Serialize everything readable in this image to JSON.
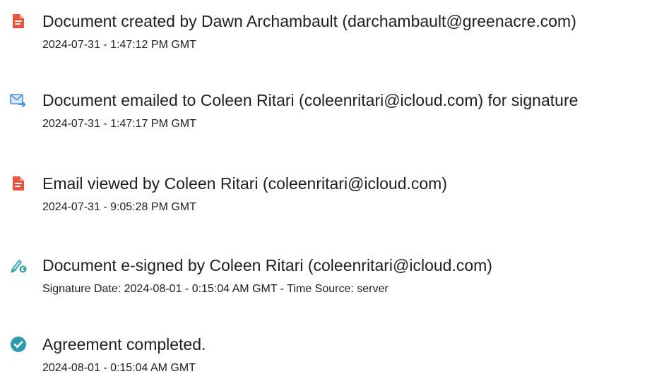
{
  "events": [
    {
      "icon": "document-icon",
      "title": "Document created by Dawn Archambault (darchambault@greenacre.com)",
      "meta": "2024-07-31 - 1:47:12 PM GMT"
    },
    {
      "icon": "email-sent-icon",
      "title": "Document emailed to Coleen Ritari (coleenritari@icloud.com) for signature",
      "meta": "2024-07-31 - 1:47:17 PM GMT"
    },
    {
      "icon": "document-icon",
      "title": "Email viewed by Coleen Ritari (coleenritari@icloud.com)",
      "meta": "2024-07-31 - 9:05:28 PM GMT"
    },
    {
      "icon": "e-sign-pen-icon",
      "title": "Document e-signed by Coleen Ritari (coleenritari@icloud.com)",
      "meta": "Signature Date: 2024-08-01 - 0:15:04 AM GMT - Time Source: server"
    },
    {
      "icon": "check-circle-icon",
      "title": "Agreement completed.",
      "meta": "2024-08-01 - 0:15:04 AM GMT"
    }
  ],
  "colors": {
    "document_icon": "#e8553f",
    "email_icon": "#4a90d9",
    "sign_icon": "#2e9fa6",
    "check_icon": "#2c9bb0",
    "text": "#1f1f1f"
  }
}
